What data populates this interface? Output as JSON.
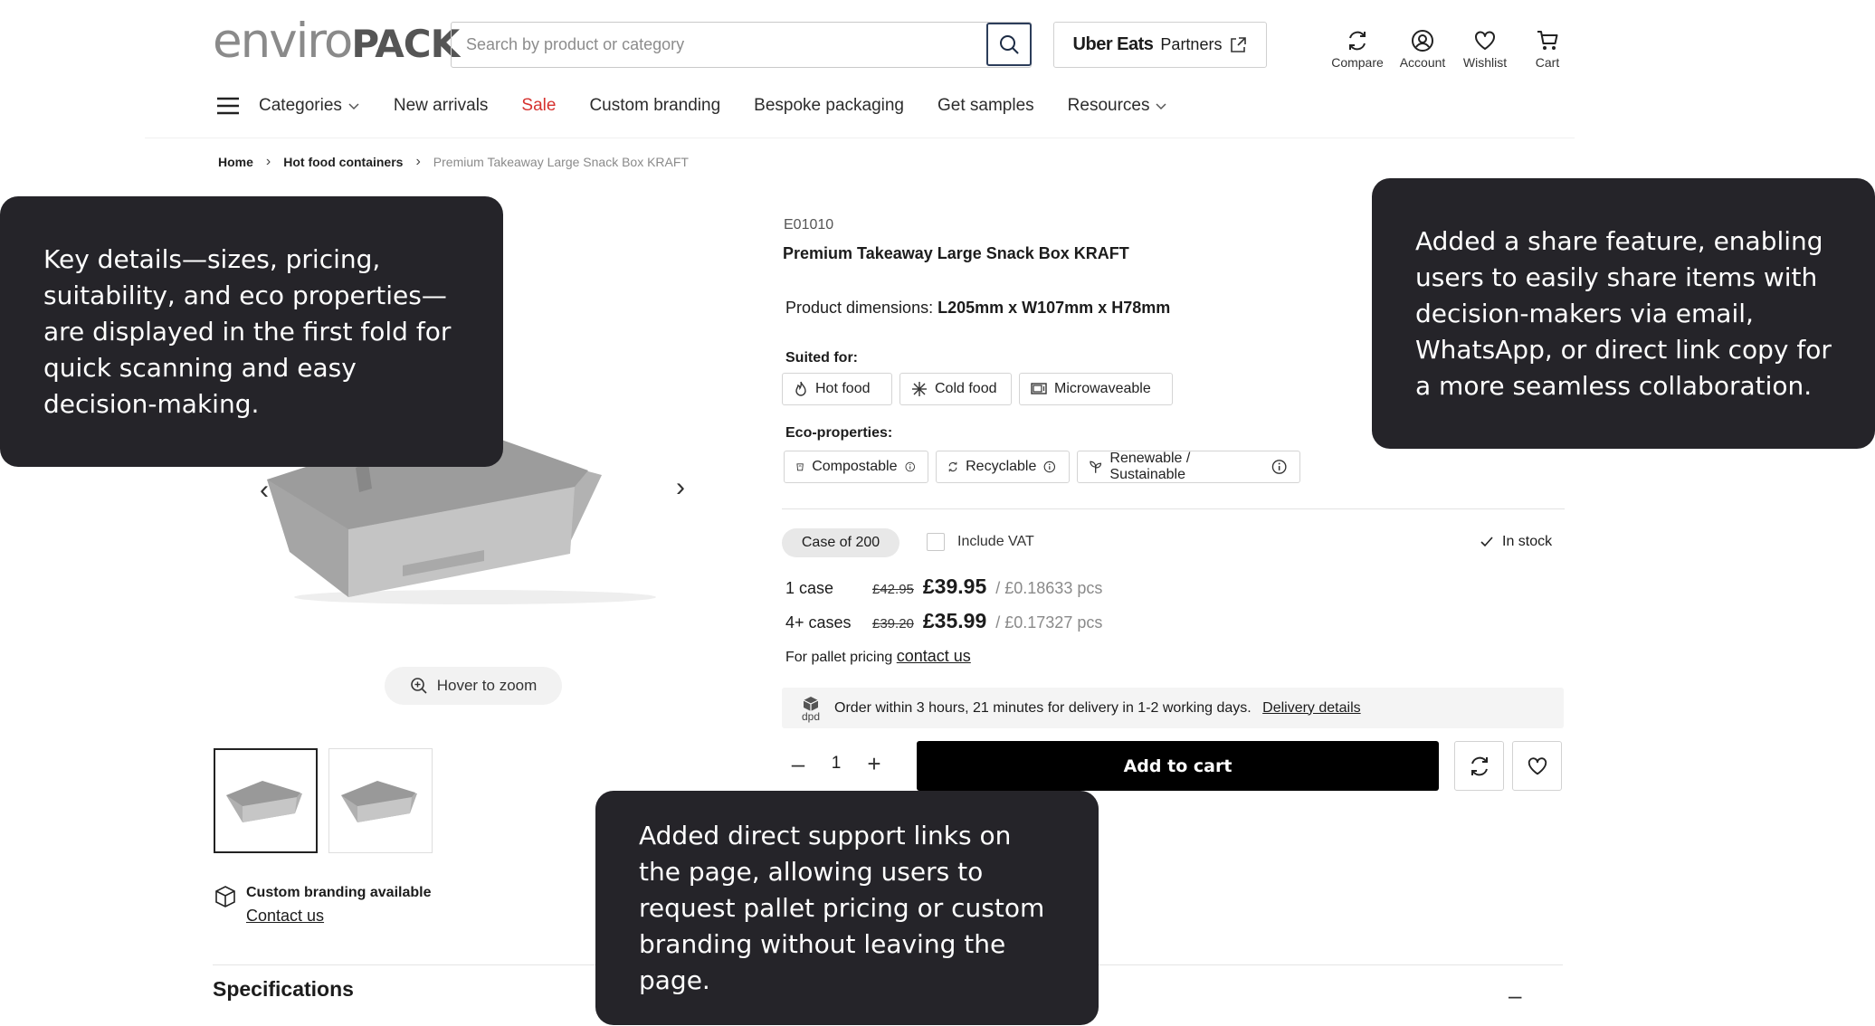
{
  "header": {
    "logo_light": "enviro",
    "logo_bold": "PACK",
    "search_placeholder": "Search by product or category",
    "uber_logo": "Uber Eats",
    "uber_label": "Partners",
    "icons": [
      {
        "label": "Compare",
        "icon": "refresh-icon"
      },
      {
        "label": "Account",
        "icon": "user-icon"
      },
      {
        "label": "Wishlist",
        "icon": "heart-icon"
      },
      {
        "label": "Cart",
        "icon": "cart-icon"
      }
    ]
  },
  "nav": {
    "categories": "Categories",
    "items": [
      "New arrivals",
      "Sale",
      "Custom branding",
      "Bespoke packaging",
      "Get samples"
    ],
    "resources": "Resources",
    "sale_color": "#d6322f"
  },
  "breadcrumb": {
    "home": "Home",
    "category": "Hot food containers",
    "current": "Premium Takeaway Large Snack Box KRAFT"
  },
  "gallery": {
    "zoom_label": "Hover to zoom",
    "branding_title": "Custom branding available",
    "branding_link": "Contact us"
  },
  "specifications": {
    "title": "Specifications",
    "toggle": "–"
  },
  "product": {
    "sku": "E01010",
    "title": "Premium Takeaway Large Snack Box KRAFT",
    "dimensions_label": "Product dimensions:",
    "dimensions_value": "L205mm x W107mm x H78mm",
    "suited_label": "Suited for:",
    "suited": [
      {
        "label": "Hot food",
        "icon": "flame-icon"
      },
      {
        "label": "Cold food",
        "icon": "snowflake-icon"
      },
      {
        "label": "Microwaveable",
        "icon": "microwave-icon"
      }
    ],
    "eco_label": "Eco-properties:",
    "eco": [
      {
        "label": "Compostable",
        "icon": "compost-icon"
      },
      {
        "label": "Recyclable",
        "icon": "recycle-icon"
      },
      {
        "label": "Renewable / Sustainable",
        "icon": "sprout-icon"
      }
    ],
    "case_label": "Case of 200",
    "vat_label": "Include VAT",
    "stock_label": "In stock",
    "prices": [
      {
        "qty": "1 case",
        "old": "£42.95",
        "now": "£39.95",
        "per": "/ £0.18633 pcs"
      },
      {
        "qty": "4+ cases",
        "old": "£39.20",
        "now": "£35.99",
        "per": "/ £0.17327 pcs"
      }
    ],
    "pallet_text": "For pallet pricing",
    "pallet_link": "contact us",
    "delivery_badge": "dpd",
    "delivery_text": "Order within 3 hours, 21 minutes for delivery in 1-2 working days.",
    "delivery_link": "Delivery details",
    "quantity": "1",
    "minus": "–",
    "plus": "+",
    "add_to_cart": "Add to cart"
  },
  "callouts": {
    "key_details": "Key details—sizes, pricing, suitability, and eco properties—are displayed in the first fold for quick scanning and easy decision-making.",
    "share": "Added a share feature, enabling users to easily share items with decision-makers via email, WhatsApp, or direct link copy for a more seamless collaboration.",
    "support": "Added direct support links on the page, allowing users to request pallet pricing or custom branding without leaving the page."
  }
}
